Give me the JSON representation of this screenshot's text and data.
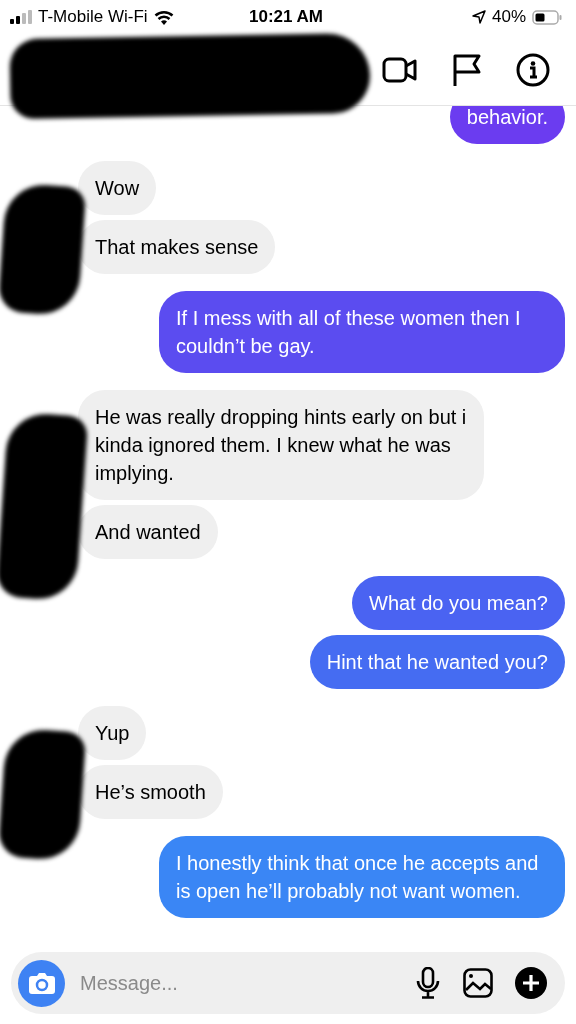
{
  "status_bar": {
    "carrier": "T-Mobile Wi-Fi",
    "time": "10:21 AM",
    "battery": "40%"
  },
  "header": {
    "actions": [
      {
        "kind": "video"
      },
      {
        "kind": "flag"
      },
      {
        "kind": "info"
      }
    ]
  },
  "groups": [
    {
      "kind": "sent",
      "messages": [
        {
          "text": "behavior.",
          "color": "#6b3cf0"
        }
      ]
    },
    {
      "kind": "received",
      "messages": [
        {
          "text": "Wow"
        },
        {
          "text": "That makes sense"
        }
      ]
    },
    {
      "kind": "sent",
      "messages": [
        {
          "text": "If I mess with all of these women then I couldn’t be gay.",
          "color": "#5b4cf0"
        }
      ]
    },
    {
      "kind": "received",
      "messages": [
        {
          "text": "He was really dropping hints early on but i kinda ignored them. I knew what he was implying."
        },
        {
          "text": "And wanted"
        }
      ]
    },
    {
      "kind": "sent",
      "messages": [
        {
          "text": "What do you mean?",
          "color": "#4a63f2"
        },
        {
          "text": "Hint that he wanted you?",
          "color": "#456cf2"
        }
      ]
    },
    {
      "kind": "received",
      "messages": [
        {
          "text": "Yup"
        },
        {
          "text": "He’s smooth"
        }
      ]
    },
    {
      "kind": "sent",
      "messages": [
        {
          "text": "I honestly think that once he accepts and is open he’ll probably not want women.",
          "color": "#3a86f5"
        }
      ]
    }
  ],
  "composer": {
    "placeholder": "Message..."
  }
}
